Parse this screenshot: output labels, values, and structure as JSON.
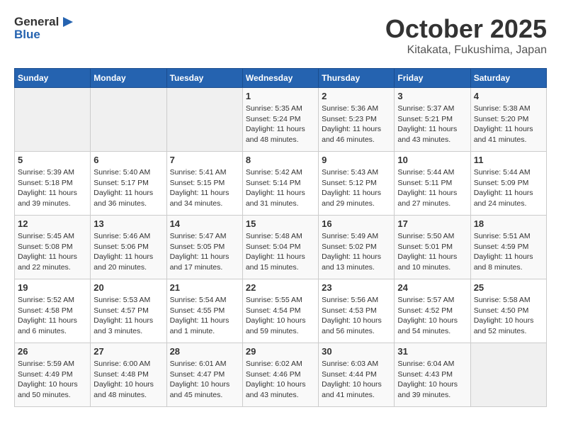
{
  "header": {
    "logo_line1": "General",
    "logo_line2": "Blue",
    "month": "October 2025",
    "location": "Kitakata, Fukushima, Japan"
  },
  "weekdays": [
    "Sunday",
    "Monday",
    "Tuesday",
    "Wednesday",
    "Thursday",
    "Friday",
    "Saturday"
  ],
  "weeks": [
    [
      {
        "day": "",
        "sunrise": "",
        "sunset": "",
        "daylight": ""
      },
      {
        "day": "",
        "sunrise": "",
        "sunset": "",
        "daylight": ""
      },
      {
        "day": "",
        "sunrise": "",
        "sunset": "",
        "daylight": ""
      },
      {
        "day": "1",
        "sunrise": "Sunrise: 5:35 AM",
        "sunset": "Sunset: 5:24 PM",
        "daylight": "Daylight: 11 hours and 48 minutes."
      },
      {
        "day": "2",
        "sunrise": "Sunrise: 5:36 AM",
        "sunset": "Sunset: 5:23 PM",
        "daylight": "Daylight: 11 hours and 46 minutes."
      },
      {
        "day": "3",
        "sunrise": "Sunrise: 5:37 AM",
        "sunset": "Sunset: 5:21 PM",
        "daylight": "Daylight: 11 hours and 43 minutes."
      },
      {
        "day": "4",
        "sunrise": "Sunrise: 5:38 AM",
        "sunset": "Sunset: 5:20 PM",
        "daylight": "Daylight: 11 hours and 41 minutes."
      }
    ],
    [
      {
        "day": "5",
        "sunrise": "Sunrise: 5:39 AM",
        "sunset": "Sunset: 5:18 PM",
        "daylight": "Daylight: 11 hours and 39 minutes."
      },
      {
        "day": "6",
        "sunrise": "Sunrise: 5:40 AM",
        "sunset": "Sunset: 5:17 PM",
        "daylight": "Daylight: 11 hours and 36 minutes."
      },
      {
        "day": "7",
        "sunrise": "Sunrise: 5:41 AM",
        "sunset": "Sunset: 5:15 PM",
        "daylight": "Daylight: 11 hours and 34 minutes."
      },
      {
        "day": "8",
        "sunrise": "Sunrise: 5:42 AM",
        "sunset": "Sunset: 5:14 PM",
        "daylight": "Daylight: 11 hours and 31 minutes."
      },
      {
        "day": "9",
        "sunrise": "Sunrise: 5:43 AM",
        "sunset": "Sunset: 5:12 PM",
        "daylight": "Daylight: 11 hours and 29 minutes."
      },
      {
        "day": "10",
        "sunrise": "Sunrise: 5:44 AM",
        "sunset": "Sunset: 5:11 PM",
        "daylight": "Daylight: 11 hours and 27 minutes."
      },
      {
        "day": "11",
        "sunrise": "Sunrise: 5:44 AM",
        "sunset": "Sunset: 5:09 PM",
        "daylight": "Daylight: 11 hours and 24 minutes."
      }
    ],
    [
      {
        "day": "12",
        "sunrise": "Sunrise: 5:45 AM",
        "sunset": "Sunset: 5:08 PM",
        "daylight": "Daylight: 11 hours and 22 minutes."
      },
      {
        "day": "13",
        "sunrise": "Sunrise: 5:46 AM",
        "sunset": "Sunset: 5:06 PM",
        "daylight": "Daylight: 11 hours and 20 minutes."
      },
      {
        "day": "14",
        "sunrise": "Sunrise: 5:47 AM",
        "sunset": "Sunset: 5:05 PM",
        "daylight": "Daylight: 11 hours and 17 minutes."
      },
      {
        "day": "15",
        "sunrise": "Sunrise: 5:48 AM",
        "sunset": "Sunset: 5:04 PM",
        "daylight": "Daylight: 11 hours and 15 minutes."
      },
      {
        "day": "16",
        "sunrise": "Sunrise: 5:49 AM",
        "sunset": "Sunset: 5:02 PM",
        "daylight": "Daylight: 11 hours and 13 minutes."
      },
      {
        "day": "17",
        "sunrise": "Sunrise: 5:50 AM",
        "sunset": "Sunset: 5:01 PM",
        "daylight": "Daylight: 11 hours and 10 minutes."
      },
      {
        "day": "18",
        "sunrise": "Sunrise: 5:51 AM",
        "sunset": "Sunset: 4:59 PM",
        "daylight": "Daylight: 11 hours and 8 minutes."
      }
    ],
    [
      {
        "day": "19",
        "sunrise": "Sunrise: 5:52 AM",
        "sunset": "Sunset: 4:58 PM",
        "daylight": "Daylight: 11 hours and 6 minutes."
      },
      {
        "day": "20",
        "sunrise": "Sunrise: 5:53 AM",
        "sunset": "Sunset: 4:57 PM",
        "daylight": "Daylight: 11 hours and 3 minutes."
      },
      {
        "day": "21",
        "sunrise": "Sunrise: 5:54 AM",
        "sunset": "Sunset: 4:55 PM",
        "daylight": "Daylight: 11 hours and 1 minute."
      },
      {
        "day": "22",
        "sunrise": "Sunrise: 5:55 AM",
        "sunset": "Sunset: 4:54 PM",
        "daylight": "Daylight: 10 hours and 59 minutes."
      },
      {
        "day": "23",
        "sunrise": "Sunrise: 5:56 AM",
        "sunset": "Sunset: 4:53 PM",
        "daylight": "Daylight: 10 hours and 56 minutes."
      },
      {
        "day": "24",
        "sunrise": "Sunrise: 5:57 AM",
        "sunset": "Sunset: 4:52 PM",
        "daylight": "Daylight: 10 hours and 54 minutes."
      },
      {
        "day": "25",
        "sunrise": "Sunrise: 5:58 AM",
        "sunset": "Sunset: 4:50 PM",
        "daylight": "Daylight: 10 hours and 52 minutes."
      }
    ],
    [
      {
        "day": "26",
        "sunrise": "Sunrise: 5:59 AM",
        "sunset": "Sunset: 4:49 PM",
        "daylight": "Daylight: 10 hours and 50 minutes."
      },
      {
        "day": "27",
        "sunrise": "Sunrise: 6:00 AM",
        "sunset": "Sunset: 4:48 PM",
        "daylight": "Daylight: 10 hours and 48 minutes."
      },
      {
        "day": "28",
        "sunrise": "Sunrise: 6:01 AM",
        "sunset": "Sunset: 4:47 PM",
        "daylight": "Daylight: 10 hours and 45 minutes."
      },
      {
        "day": "29",
        "sunrise": "Sunrise: 6:02 AM",
        "sunset": "Sunset: 4:46 PM",
        "daylight": "Daylight: 10 hours and 43 minutes."
      },
      {
        "day": "30",
        "sunrise": "Sunrise: 6:03 AM",
        "sunset": "Sunset: 4:44 PM",
        "daylight": "Daylight: 10 hours and 41 minutes."
      },
      {
        "day": "31",
        "sunrise": "Sunrise: 6:04 AM",
        "sunset": "Sunset: 4:43 PM",
        "daylight": "Daylight: 10 hours and 39 minutes."
      },
      {
        "day": "",
        "sunrise": "",
        "sunset": "",
        "daylight": ""
      }
    ]
  ]
}
